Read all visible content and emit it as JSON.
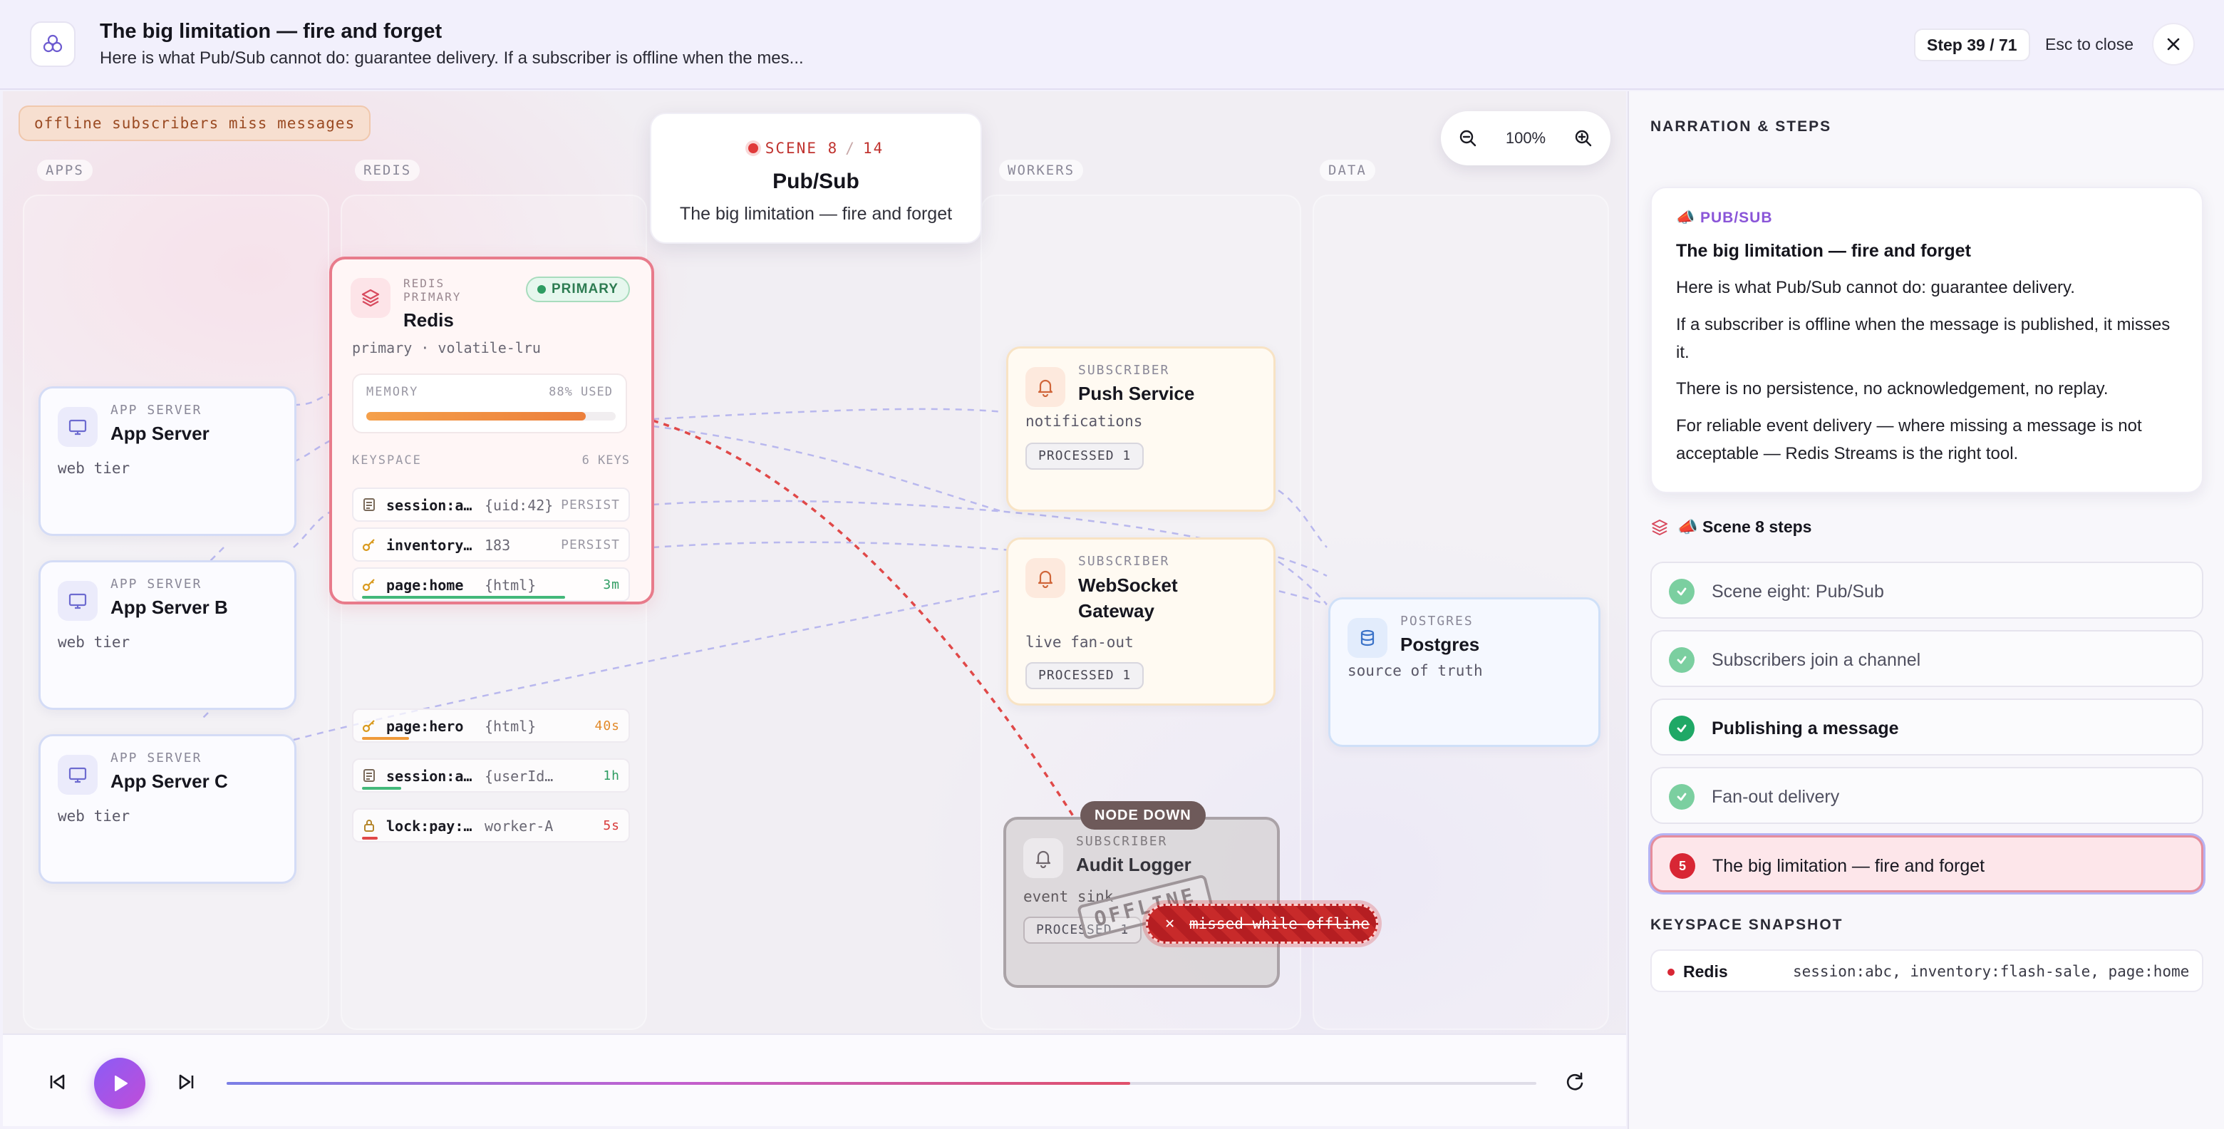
{
  "header": {
    "title": "The big limitation — fire and forget",
    "subtitle": "Here is what Pub/Sub cannot do: guarantee delivery. If a subscriber is offline when the mes...",
    "step_counter": "Step 39 / 71",
    "esc_hint": "Esc to close",
    "logo_icon": "logo-icon",
    "close_icon": "close-icon"
  },
  "canvas": {
    "alert": "offline subscribers miss messages",
    "lanes": [
      "APPS",
      "REDIS",
      "WORKERS",
      "DATA"
    ],
    "scene": {
      "tag": "SCENE 8",
      "total": "14",
      "title": "Pub/Sub",
      "subtitle": "The big limitation — fire and forget"
    },
    "zoom": "100%",
    "apps": [
      {
        "kind": "APP SERVER",
        "title": "App Server",
        "desc": "web tier"
      },
      {
        "kind": "APP SERVER",
        "title": "App Server B",
        "desc": "web tier"
      },
      {
        "kind": "APP SERVER",
        "title": "App Server C",
        "desc": "web tier"
      }
    ],
    "redis": {
      "kind_line1": "REDIS",
      "kind_line2": "PRIMARY",
      "title": "Redis",
      "badge": "PRIMARY",
      "desc": "primary · volatile-lru",
      "memory_label": "MEMORY",
      "memory_used_label": "88% USED",
      "memory_fraction": 0.88,
      "keyspace_label": "KEYSPACE",
      "keyspace_count": "6 KEYS",
      "keys": [
        {
          "name": "session:a…",
          "value": "{uid:42}",
          "ttl": "PERSIST",
          "icon": "document-icon",
          "ttl_color": "#9a98a4",
          "bar_color": "",
          "bar_fraction": 0
        },
        {
          "name": "inventory…",
          "value": "183",
          "ttl": "PERSIST",
          "icon": "key-icon",
          "ttl_color": "#9a98a4",
          "bar_color": "",
          "bar_fraction": 0
        },
        {
          "name": "page:home",
          "value": "{html}",
          "ttl": "3m",
          "icon": "key-icon",
          "ttl_color": "#2e9c62",
          "bar_color": "#43b87a",
          "bar_fraction": 0.78
        },
        {
          "name": "page:hero",
          "value": "{html}",
          "ttl": "40s",
          "icon": "key-icon",
          "ttl_color": "#e28a2a",
          "bar_color": "#ef9a3a",
          "bar_fraction": 0.18
        },
        {
          "name": "session:a…",
          "value": "{userId…",
          "ttl": "1h",
          "icon": "document-icon",
          "ttl_color": "#2e9c62",
          "bar_color": "#43b87a",
          "bar_fraction": 0.15
        },
        {
          "name": "lock:pay:…",
          "value": "worker-A",
          "ttl": "5s",
          "icon": "lock-icon",
          "ttl_color": "#d83a3a",
          "bar_color": "#e04848",
          "bar_fraction": 0.06
        }
      ]
    },
    "subscribers": [
      {
        "kind": "SUBSCRIBER",
        "title": "Push Service",
        "desc": "notifications",
        "processed": "PROCESSED 1"
      },
      {
        "kind": "SUBSCRIBER",
        "title": "WebSocket Gateway",
        "title_l1": "WebSocket",
        "title_l2": "Gateway",
        "desc": "live fan-out",
        "processed": "PROCESSED 1"
      },
      {
        "kind": "SUBSCRIBER",
        "title": "Audit Logger",
        "desc": "event sink",
        "processed": "PROCESSED 1"
      }
    ],
    "postgres": {
      "kind": "POSTGRES",
      "title": "Postgres",
      "desc": "source of truth"
    },
    "node_down": "NODE DOWN",
    "offline_stamp": "OFFLINE",
    "missed": "missed while offline",
    "colors": {
      "accent": "#8b5cf6",
      "danger": "#d82634",
      "redis_border": "#e87b8b",
      "success": "#1fa866"
    }
  },
  "playback": {
    "progress_fraction": 0.69,
    "icons": [
      "skip-back-icon",
      "play-icon",
      "skip-forward-icon",
      "restart-icon"
    ]
  },
  "panel": {
    "heading": "NARRATION & STEPS",
    "narration": {
      "tag": "📣 PUB/SUB",
      "title": "The big limitation — fire and forget",
      "paragraphs": [
        "Here is what Pub/Sub cannot do: guarantee delivery.",
        "If a subscriber is offline when the message is published, it misses it.",
        "There is no persistence, no acknowledgement, no replay.",
        "For reliable event delivery — where missing a message is not acceptable — Redis Streams is the right tool."
      ]
    },
    "steps_heading": "📣 Scene 8 steps",
    "steps": [
      {
        "label": "Scene eight: Pub/Sub",
        "state": "done"
      },
      {
        "label": "Subscribers join a channel",
        "state": "done"
      },
      {
        "label": "Publishing a message",
        "state": "done-strong"
      },
      {
        "label": "Fan-out delivery",
        "state": "done"
      },
      {
        "label": "The big limitation — fire and forget",
        "state": "active",
        "number": "5"
      }
    ],
    "keyspace_heading": "KEYSPACE SNAPSHOT",
    "keyspace": {
      "name": "Redis",
      "keys": "session:abc, inventory:flash-sale, page:home"
    }
  }
}
